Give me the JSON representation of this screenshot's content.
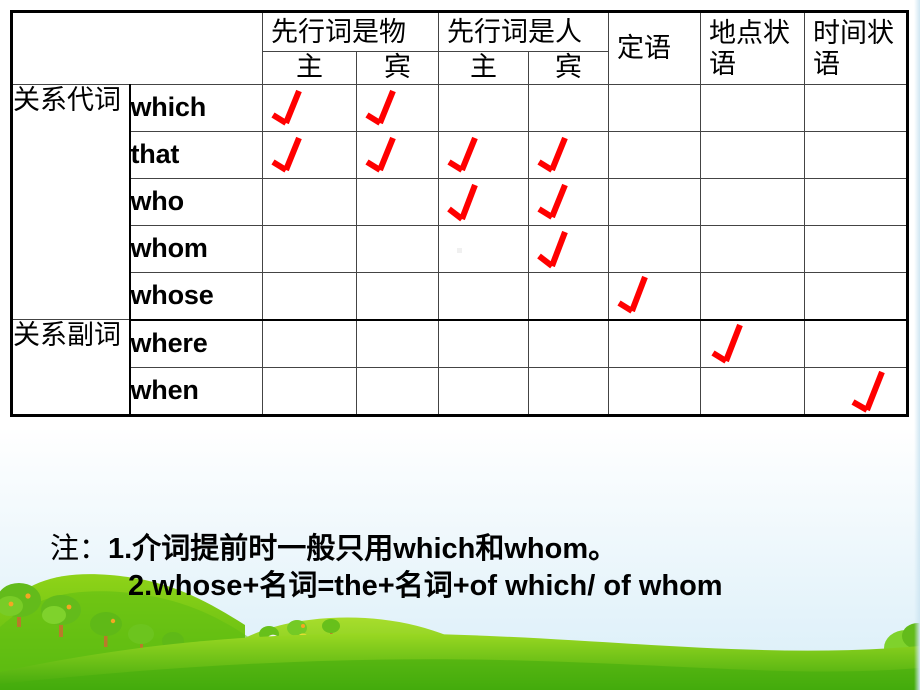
{
  "table": {
    "corner_label": "",
    "column_groups": [
      {
        "label": "先行词是物",
        "subcolumns": [
          "主",
          "宾"
        ]
      },
      {
        "label": "先行词是人",
        "subcolumns": [
          "主",
          "宾"
        ]
      },
      {
        "label": "定语",
        "subcolumns": []
      },
      {
        "label": "地点状语",
        "subcolumns": []
      },
      {
        "label": "时间状语",
        "subcolumns": []
      }
    ],
    "column_keys": [
      "thing_subject",
      "thing_object",
      "person_subject",
      "person_object",
      "attributive",
      "place_adverbial",
      "time_adverbial"
    ],
    "row_groups": [
      {
        "label": "关系代词",
        "rows": [
          {
            "word": "which",
            "marks": [
              true,
              true,
              false,
              false,
              false,
              false,
              false
            ]
          },
          {
            "word": "that",
            "marks": [
              true,
              true,
              true,
              true,
              false,
              false,
              false
            ]
          },
          {
            "word": "who",
            "marks": [
              false,
              false,
              true,
              true,
              false,
              false,
              false
            ]
          },
          {
            "word": "whom",
            "marks": [
              false,
              false,
              false,
              true,
              false,
              false,
              false
            ]
          },
          {
            "word": "whose",
            "marks": [
              false,
              false,
              false,
              false,
              true,
              false,
              false
            ]
          }
        ]
      },
      {
        "label": "关系副词",
        "rows": [
          {
            "word": "where",
            "marks": [
              false,
              false,
              false,
              false,
              false,
              true,
              false
            ]
          },
          {
            "word": "when",
            "marks": [
              false,
              false,
              false,
              false,
              false,
              false,
              true
            ]
          }
        ]
      }
    ]
  },
  "notes": {
    "heading": "注：",
    "items": [
      "1.介词提前时一般只用which和whom。",
      "2.whose+名词=the+名词+of which/ of whom"
    ]
  },
  "colors": {
    "check_mark": "#ff0000",
    "table_border": "#000000",
    "grid_line": "#444444",
    "text": "#000000",
    "hill_dark_green": "#4caf1d",
    "hill_mid_green": "#7ec820",
    "hill_light_green": "#a6d92a",
    "sky": "#d9eef8",
    "flower_yellow": "#f7e034",
    "flower_white": "#ffffff"
  },
  "icons": {
    "check": "check-mark-icon",
    "tree": "tree-icon",
    "flower": "flower-icon",
    "hill": "hill-icon"
  }
}
